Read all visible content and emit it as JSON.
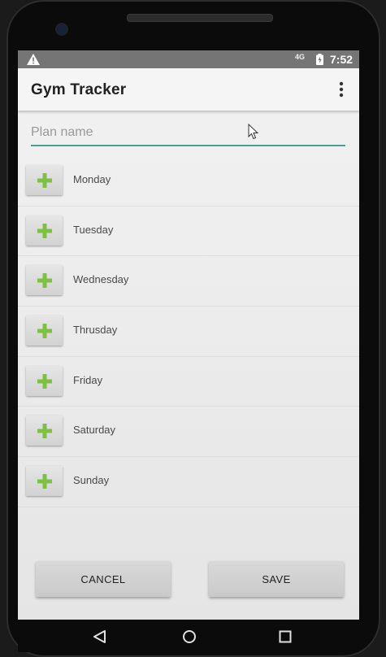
{
  "status_bar": {
    "network": "4G",
    "time": "7:52"
  },
  "app_bar": {
    "title": "Gym Tracker"
  },
  "plan_name_field": {
    "placeholder": "Plan name",
    "value": ""
  },
  "days": [
    {
      "label": "Monday"
    },
    {
      "label": "Tuesday"
    },
    {
      "label": "Wednesday"
    },
    {
      "label": "Thrusday"
    },
    {
      "label": "Friday"
    },
    {
      "label": "Saturday"
    },
    {
      "label": "Sunday"
    }
  ],
  "buttons": {
    "cancel_label": "CANCEL",
    "save_label": "SAVE"
  },
  "icons": {
    "add": "plus-icon",
    "overflow": "overflow-menu-icon",
    "status_warning": "warning-icon",
    "battery": "battery-icon",
    "nav_back": "back-icon",
    "nav_home": "home-icon",
    "nav_recent": "recent-apps-icon"
  },
  "colors": {
    "accent_underline": "#4a9e8f",
    "plus_green": "#7cc142",
    "status_bar": "#757575",
    "app_bar": "#f5f5f5"
  }
}
